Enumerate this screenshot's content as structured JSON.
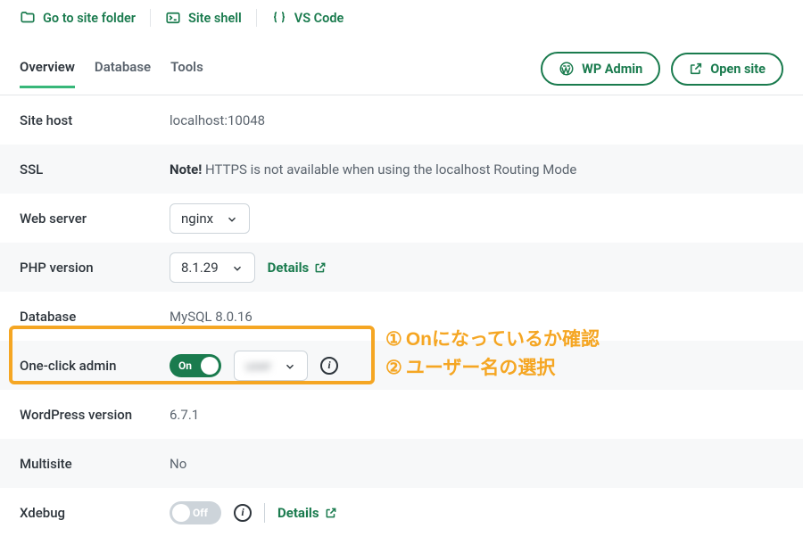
{
  "topbar": {
    "site_folder": "Go to site folder",
    "site_shell": "Site shell",
    "vscode": "VS Code"
  },
  "tabs": {
    "overview": "Overview",
    "database": "Database",
    "tools": "Tools"
  },
  "actions": {
    "wp_admin": "WP Admin",
    "open_site": "Open site"
  },
  "rows": {
    "site_host": {
      "label": "Site host",
      "value": "localhost:10048"
    },
    "ssl": {
      "label": "SSL",
      "note_bold": "Note!",
      "note_rest": " HTTPS is not available when using the localhost Routing Mode"
    },
    "web_server": {
      "label": "Web server",
      "value": "nginx"
    },
    "php": {
      "label": "PHP version",
      "value": "8.1.29",
      "details": "Details"
    },
    "database": {
      "label": "Database",
      "value": "MySQL 8.0.16"
    },
    "oneclick": {
      "label": "One-click admin",
      "toggle_on": "On",
      "user_placeholder": "user"
    },
    "wp_version": {
      "label": "WordPress version",
      "value": "6.7.1"
    },
    "multisite": {
      "label": "Multisite",
      "value": "No"
    },
    "xdebug": {
      "label": "Xdebug",
      "toggle_off": "Off",
      "details": "Details"
    }
  },
  "annotation": {
    "line1_num": "①",
    "line1": "Onになっているか確認",
    "line2_num": "②",
    "line2": "ユーザー名の選択"
  }
}
